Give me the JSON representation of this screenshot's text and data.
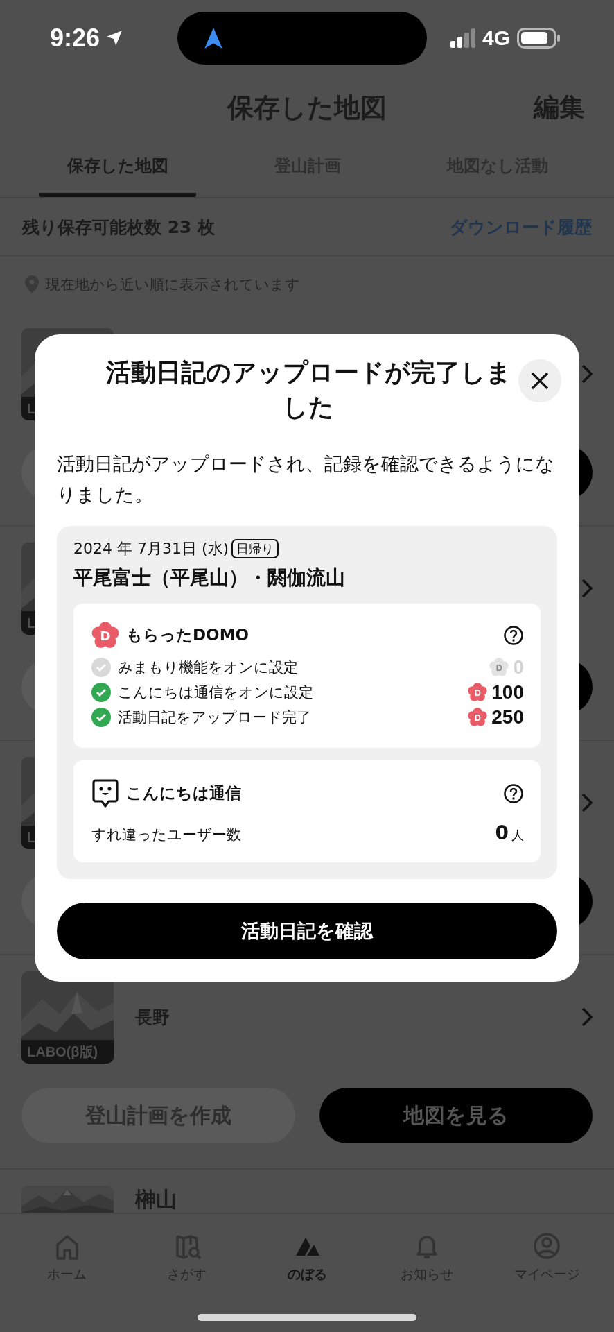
{
  "status_bar": {
    "time": "9:26",
    "network": "4G"
  },
  "header": {
    "title": "保存した地図",
    "action": "編集"
  },
  "tabs": [
    {
      "label": "保存した地図",
      "selected": true
    },
    {
      "label": "登山計画",
      "selected": false
    },
    {
      "label": "地図なし活動",
      "selected": false
    }
  ],
  "quota": {
    "label": "残り保存可能枚数 23 枚",
    "link": "ダウンロード履歴"
  },
  "sort_note": "現在地から近い順に表示されています",
  "maps": [
    {
      "badge": "L",
      "buttons": [
        {
          "disabled": true
        },
        {
          "disabled": false
        }
      ]
    },
    {
      "badge": "L",
      "buttons": [
        {
          "disabled": true
        },
        {
          "disabled": false
        }
      ]
    },
    {
      "badge": "L",
      "buttons": [
        {
          "disabled": true
        },
        {
          "disabled": false
        }
      ]
    },
    {
      "title": "長野",
      "badge": "LABO(β版)",
      "buttons": [
        {
          "label": "登山計画を作成",
          "disabled": true
        },
        {
          "label": "地図を見る",
          "disabled": false
        }
      ]
    },
    {
      "title": "榊山"
    }
  ],
  "modal": {
    "title": "活動日記のアップロードが完了しました",
    "message": "活動日記がアップロードされ、記録を確認できるようになりました。",
    "record": {
      "date": "2024 年 7月31日 (水)",
      "trip_type": "日帰り",
      "title": "平尾富士（平尾山）・閼伽流山"
    },
    "domo": {
      "icon_letter": "D",
      "title": "もらったDOMO",
      "items": [
        {
          "label": "みまもり機能をオンに設定",
          "achieved": false,
          "icon_letter": "D",
          "points": "0"
        },
        {
          "label": "こんにちは通信をオンに設定",
          "achieved": true,
          "icon_letter": "D",
          "points": "100"
        },
        {
          "label": "活動日記をアップロード完了",
          "achieved": true,
          "icon_letter": "D",
          "points": "250"
        }
      ]
    },
    "encounter": {
      "title": "こんにちは通信",
      "label": "すれ違ったユーザー数",
      "count": "0",
      "unit": "人"
    },
    "button": "活動日記を確認"
  },
  "tab_bar": [
    {
      "label": "ホーム",
      "selected": false
    },
    {
      "label": "さがす",
      "selected": false
    },
    {
      "label": "のぼる",
      "selected": true
    },
    {
      "label": "お知らせ",
      "selected": false
    },
    {
      "label": "マイページ",
      "selected": false
    }
  ]
}
